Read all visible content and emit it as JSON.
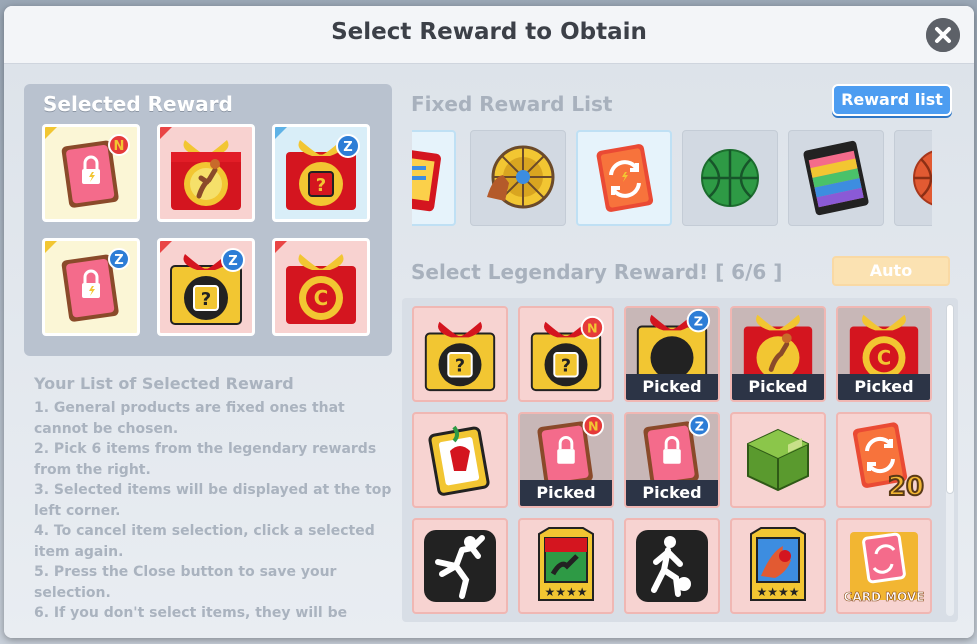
{
  "dialog": {
    "title": "Select Reward to Obtain",
    "close_icon": "close-icon"
  },
  "selected": {
    "title": "Selected Reward",
    "items": [
      {
        "icon": "lock-card-icon",
        "badge": "N"
      },
      {
        "icon": "gift-box-player-icon",
        "badge": ""
      },
      {
        "icon": "gift-box-question-icon",
        "badge": "Z"
      },
      {
        "icon": "lock-card-icon",
        "badge": "Z"
      },
      {
        "icon": "gold-box-question-icon",
        "badge": "Z"
      },
      {
        "icon": "gift-box-coin-icon",
        "badge": ""
      }
    ]
  },
  "guide": {
    "title": "Your List of Selected Reward",
    "lines": [
      "1. General products are fixed ones that cannot be chosen.",
      "2. Pick 6 items from the legendary rewards from the right.",
      "3. Selected items will be displayed at the top left corner.",
      "4. To cancel item selection, click a selected item again.",
      "5. Press the Close button to save your selection.",
      "6. If you don't select items, they will be"
    ]
  },
  "fixed": {
    "title": "Fixed Reward List",
    "button": "Reward list",
    "items": [
      "card-fragment-icon",
      "wheel-spinner-icon",
      "swap-card-icon",
      "green-ball-icon",
      "rainbow-jersey-icon",
      "orange-ball-icon"
    ]
  },
  "legendary": {
    "title": "Select Legendary Reward! [ 6/6 ]",
    "auto_label": "Auto",
    "picked_label": "Picked",
    "items": [
      {
        "icon": "gold-box-question-icon",
        "badge": "",
        "picked": false
      },
      {
        "icon": "gold-box-question-icon",
        "badge": "N",
        "picked": false
      },
      {
        "icon": "gold-box-question-icon",
        "badge": "Z",
        "picked": true
      },
      {
        "icon": "gift-box-player-icon",
        "badge": "",
        "picked": true
      },
      {
        "icon": "gift-box-coin-icon",
        "badge": "",
        "picked": true
      },
      {
        "icon": "mascot-card-icon",
        "badge": "",
        "picked": false
      },
      {
        "icon": "lock-card-icon",
        "badge": "N",
        "picked": true
      },
      {
        "icon": "lock-card-icon",
        "badge": "Z",
        "picked": true
      },
      {
        "icon": "green-crate-icon",
        "badge": "",
        "picked": false
      },
      {
        "icon": "swap-card-20-icon",
        "badge": "",
        "picked": false
      },
      {
        "icon": "dunk-silhouette-icon",
        "badge": "",
        "picked": false
      },
      {
        "icon": "player-card-4star-icon",
        "badge": "",
        "picked": false
      },
      {
        "icon": "dribble-silhouette-icon",
        "badge": "",
        "picked": false
      },
      {
        "icon": "fire-card-4star-icon",
        "badge": "",
        "picked": false
      },
      {
        "icon": "card-move-icon",
        "badge": "",
        "picked": false
      }
    ],
    "swap_count": "20",
    "card_move_label": "CARD MOVE"
  },
  "colors": {
    "accent_blue": "#4d9df1",
    "picked_bar": "#2c3446",
    "tile_pink": "#f7d3d1"
  }
}
